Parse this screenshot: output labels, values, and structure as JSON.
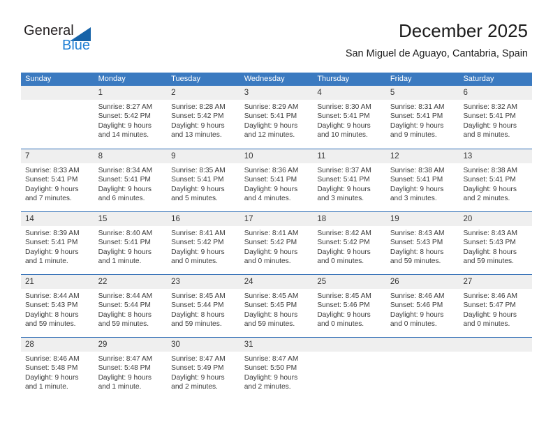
{
  "logo": {
    "word_one": "General",
    "word_two": "Blue",
    "triangle_color": "#1763a8",
    "blue_text_color": "#1f7fd4"
  },
  "header": {
    "month_title": "December 2025",
    "location": "San Miguel de Aguayo, Cantabria, Spain"
  },
  "theme": {
    "header_blue": "#3b7ac0",
    "row_divider_blue": "#2f6db5",
    "day_strip_gray": "#efefef"
  },
  "weekdays": [
    "Sunday",
    "Monday",
    "Tuesday",
    "Wednesday",
    "Thursday",
    "Friday",
    "Saturday"
  ],
  "weeks": [
    [
      {
        "day": "",
        "lines": []
      },
      {
        "day": "1",
        "lines": [
          "Sunrise: 8:27 AM",
          "Sunset: 5:42 PM",
          "Daylight: 9 hours",
          "and 14 minutes."
        ]
      },
      {
        "day": "2",
        "lines": [
          "Sunrise: 8:28 AM",
          "Sunset: 5:42 PM",
          "Daylight: 9 hours",
          "and 13 minutes."
        ]
      },
      {
        "day": "3",
        "lines": [
          "Sunrise: 8:29 AM",
          "Sunset: 5:41 PM",
          "Daylight: 9 hours",
          "and 12 minutes."
        ]
      },
      {
        "day": "4",
        "lines": [
          "Sunrise: 8:30 AM",
          "Sunset: 5:41 PM",
          "Daylight: 9 hours",
          "and 10 minutes."
        ]
      },
      {
        "day": "5",
        "lines": [
          "Sunrise: 8:31 AM",
          "Sunset: 5:41 PM",
          "Daylight: 9 hours",
          "and 9 minutes."
        ]
      },
      {
        "day": "6",
        "lines": [
          "Sunrise: 8:32 AM",
          "Sunset: 5:41 PM",
          "Daylight: 9 hours",
          "and 8 minutes."
        ]
      }
    ],
    [
      {
        "day": "7",
        "lines": [
          "Sunrise: 8:33 AM",
          "Sunset: 5:41 PM",
          "Daylight: 9 hours",
          "and 7 minutes."
        ]
      },
      {
        "day": "8",
        "lines": [
          "Sunrise: 8:34 AM",
          "Sunset: 5:41 PM",
          "Daylight: 9 hours",
          "and 6 minutes."
        ]
      },
      {
        "day": "9",
        "lines": [
          "Sunrise: 8:35 AM",
          "Sunset: 5:41 PM",
          "Daylight: 9 hours",
          "and 5 minutes."
        ]
      },
      {
        "day": "10",
        "lines": [
          "Sunrise: 8:36 AM",
          "Sunset: 5:41 PM",
          "Daylight: 9 hours",
          "and 4 minutes."
        ]
      },
      {
        "day": "11",
        "lines": [
          "Sunrise: 8:37 AM",
          "Sunset: 5:41 PM",
          "Daylight: 9 hours",
          "and 3 minutes."
        ]
      },
      {
        "day": "12",
        "lines": [
          "Sunrise: 8:38 AM",
          "Sunset: 5:41 PM",
          "Daylight: 9 hours",
          "and 3 minutes."
        ]
      },
      {
        "day": "13",
        "lines": [
          "Sunrise: 8:38 AM",
          "Sunset: 5:41 PM",
          "Daylight: 9 hours",
          "and 2 minutes."
        ]
      }
    ],
    [
      {
        "day": "14",
        "lines": [
          "Sunrise: 8:39 AM",
          "Sunset: 5:41 PM",
          "Daylight: 9 hours",
          "and 1 minute."
        ]
      },
      {
        "day": "15",
        "lines": [
          "Sunrise: 8:40 AM",
          "Sunset: 5:41 PM",
          "Daylight: 9 hours",
          "and 1 minute."
        ]
      },
      {
        "day": "16",
        "lines": [
          "Sunrise: 8:41 AM",
          "Sunset: 5:42 PM",
          "Daylight: 9 hours",
          "and 0 minutes."
        ]
      },
      {
        "day": "17",
        "lines": [
          "Sunrise: 8:41 AM",
          "Sunset: 5:42 PM",
          "Daylight: 9 hours",
          "and 0 minutes."
        ]
      },
      {
        "day": "18",
        "lines": [
          "Sunrise: 8:42 AM",
          "Sunset: 5:42 PM",
          "Daylight: 9 hours",
          "and 0 minutes."
        ]
      },
      {
        "day": "19",
        "lines": [
          "Sunrise: 8:43 AM",
          "Sunset: 5:43 PM",
          "Daylight: 8 hours",
          "and 59 minutes."
        ]
      },
      {
        "day": "20",
        "lines": [
          "Sunrise: 8:43 AM",
          "Sunset: 5:43 PM",
          "Daylight: 8 hours",
          "and 59 minutes."
        ]
      }
    ],
    [
      {
        "day": "21",
        "lines": [
          "Sunrise: 8:44 AM",
          "Sunset: 5:43 PM",
          "Daylight: 8 hours",
          "and 59 minutes."
        ]
      },
      {
        "day": "22",
        "lines": [
          "Sunrise: 8:44 AM",
          "Sunset: 5:44 PM",
          "Daylight: 8 hours",
          "and 59 minutes."
        ]
      },
      {
        "day": "23",
        "lines": [
          "Sunrise: 8:45 AM",
          "Sunset: 5:44 PM",
          "Daylight: 8 hours",
          "and 59 minutes."
        ]
      },
      {
        "day": "24",
        "lines": [
          "Sunrise: 8:45 AM",
          "Sunset: 5:45 PM",
          "Daylight: 8 hours",
          "and 59 minutes."
        ]
      },
      {
        "day": "25",
        "lines": [
          "Sunrise: 8:45 AM",
          "Sunset: 5:46 PM",
          "Daylight: 9 hours",
          "and 0 minutes."
        ]
      },
      {
        "day": "26",
        "lines": [
          "Sunrise: 8:46 AM",
          "Sunset: 5:46 PM",
          "Daylight: 9 hours",
          "and 0 minutes."
        ]
      },
      {
        "day": "27",
        "lines": [
          "Sunrise: 8:46 AM",
          "Sunset: 5:47 PM",
          "Daylight: 9 hours",
          "and 0 minutes."
        ]
      }
    ],
    [
      {
        "day": "28",
        "lines": [
          "Sunrise: 8:46 AM",
          "Sunset: 5:48 PM",
          "Daylight: 9 hours",
          "and 1 minute."
        ]
      },
      {
        "day": "29",
        "lines": [
          "Sunrise: 8:47 AM",
          "Sunset: 5:48 PM",
          "Daylight: 9 hours",
          "and 1 minute."
        ]
      },
      {
        "day": "30",
        "lines": [
          "Sunrise: 8:47 AM",
          "Sunset: 5:49 PM",
          "Daylight: 9 hours",
          "and 2 minutes."
        ]
      },
      {
        "day": "31",
        "lines": [
          "Sunrise: 8:47 AM",
          "Sunset: 5:50 PM",
          "Daylight: 9 hours",
          "and 2 minutes."
        ]
      },
      {
        "day": "",
        "lines": []
      },
      {
        "day": "",
        "lines": []
      },
      {
        "day": "",
        "lines": []
      }
    ]
  ]
}
